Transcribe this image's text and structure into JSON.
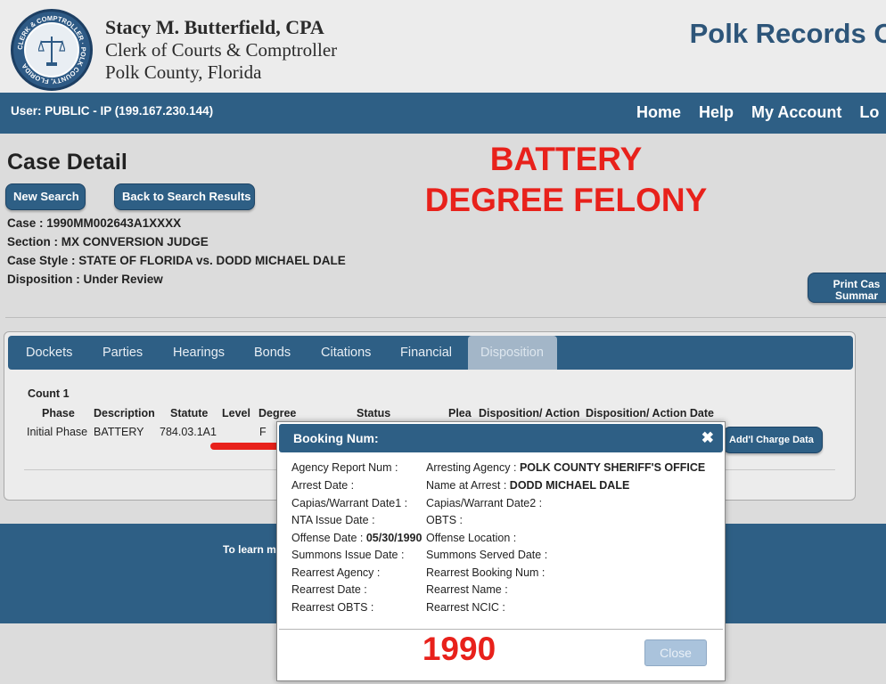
{
  "header": {
    "seal_text": "CLERK & COMPTROLLER · POLK COUNTY, FLORIDA",
    "org_name": "Stacy M. Butterfield, CPA",
    "org_line1": "Clerk of Courts & Comptroller",
    "org_line2": "Polk County, Florida",
    "site_title": "Polk Records Onl"
  },
  "navbar": {
    "user": "User: PUBLIC - IP (199.167.230.144)",
    "links": [
      "Home",
      "Help",
      "My Account",
      "Lo"
    ]
  },
  "annotations": {
    "line1": "BATTERY",
    "line2": "DEGREE FELONY",
    "year": "1990",
    "accent_color": "#e8211b"
  },
  "case": {
    "title": "Case Detail",
    "new_search": "New Search",
    "back": "Back to Search Results",
    "case_line": "Case : 1990MM002643A1XXXX",
    "section_line": "Section : MX CONVERSION JUDGE",
    "style_line": "Case Style : STATE OF FLORIDA vs. DODD MICHAEL DALE",
    "disposition_line": "Disposition : Under Review",
    "print_line1": "Print Cas",
    "print_line2": "Summar"
  },
  "tabs": [
    "Dockets",
    "Parties",
    "Hearings",
    "Bonds",
    "Citations",
    "Financial",
    "Disposition"
  ],
  "active_tab": "Disposition",
  "charges": {
    "count_label": "Count 1",
    "headers": [
      "Phase",
      "Description",
      "Statute",
      "Level",
      "Degree",
      "Status",
      "Plea",
      "Disposition/ Action",
      "Disposition/ Action Date"
    ],
    "row": {
      "phase": "Initial Phase",
      "description": "BATTERY",
      "statute": "784.03.1A1",
      "degree": "F"
    },
    "charge_button": "Add'l Charge Data"
  },
  "footer": {
    "text": "To learn m"
  },
  "modal": {
    "title": "Booking Num:",
    "left_fields": [
      {
        "label": "Agency Report Num :",
        "value": ""
      },
      {
        "label": "Arrest Date :",
        "value": ""
      },
      {
        "label": "Capias/Warrant Date1 :",
        "value": ""
      },
      {
        "label": "NTA Issue Date :",
        "value": ""
      },
      {
        "label": "Offense Date :",
        "value": "05/30/1990"
      },
      {
        "label": "Summons Issue Date :",
        "value": ""
      },
      {
        "label": "Rearrest Agency :",
        "value": ""
      },
      {
        "label": "Rearrest Date :",
        "value": ""
      },
      {
        "label": "Rearrest OBTS :",
        "value": ""
      }
    ],
    "right_fields": [
      {
        "label": "Arresting Agency :",
        "value": "POLK COUNTY SHERIFF'S OFFICE"
      },
      {
        "label": "Name at Arrest :",
        "value": "DODD MICHAEL DALE"
      },
      {
        "label": "Capias/Warrant Date2 :",
        "value": ""
      },
      {
        "label": "OBTS :",
        "value": ""
      },
      {
        "label": "Offense Location :",
        "value": ""
      },
      {
        "label": "Summons Served Date :",
        "value": ""
      },
      {
        "label": "Rearrest Booking Num :",
        "value": ""
      },
      {
        "label": "Rearrest Name :",
        "value": ""
      },
      {
        "label": "Rearrest NCIC :",
        "value": ""
      }
    ],
    "close_label": "Close"
  }
}
